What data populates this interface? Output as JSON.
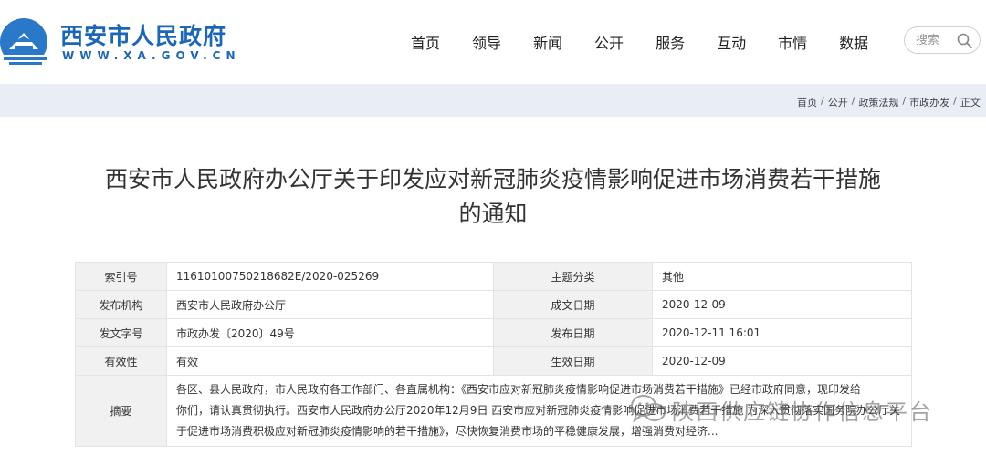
{
  "header": {
    "site_name": "西安市人民政府",
    "site_url": "WWW.XA.GOV.CN",
    "logo_icon": "city-emblem-icon",
    "brand_color": "#1a66b8"
  },
  "nav": {
    "items": [
      "首页",
      "领导",
      "新闻",
      "公开",
      "服务",
      "互动",
      "市情",
      "数据"
    ]
  },
  "search": {
    "placeholder": "搜索",
    "icon": "search-icon"
  },
  "breadcrumb": {
    "items": [
      "首页",
      "公开",
      "政策法规",
      "市政办发",
      "正文"
    ]
  },
  "article": {
    "title_line1": "西安市人民政府办公厅关于印发应对新冠肺炎疫情影响促进市场消费若干措施",
    "title_line2": "的通知"
  },
  "info": {
    "index_label": "索引号",
    "index_value": "11610100750218682E/2020-025269",
    "topic_label": "主题分类",
    "topic_value": "其他",
    "issuer_label": "发布机构",
    "issuer_value": "西安市人民政府办公厅",
    "created_label": "成文日期",
    "created_value": "2020-12-09",
    "docno_label": "发文字号",
    "docno_value": "市政办发〔2020〕49号",
    "published_label": "发布日期",
    "published_value": "2020-12-11 16:01",
    "validity_label": "有效性",
    "validity_value": "有效",
    "effective_label": "生效日期",
    "effective_value": "2020-12-09",
    "summary_label": "摘要",
    "summary_line1": "各区、县人民政府，市人民政府各工作部门、各直属机构：《西安市应对新冠肺炎疫情影响促进市场消费若干措施》已经市政府同意，现印发给",
    "summary_line2": "你们，请认真贯彻执行。西安市人民政府办公厅2020年12月9日 西安市应对新冠肺炎疫情影响促进市场消费若干措施 为深入贯彻落实国务院办公厅关",
    "summary_line3": "于促进市场消费积极应对新冠肺炎疫情影响的若干措施》，尽快恢复消费市场的平稳健康发展，增强消费对经济..."
  },
  "watermark": {
    "text": "陕西供应链协作信息平台",
    "icon": "wechat-icon"
  }
}
